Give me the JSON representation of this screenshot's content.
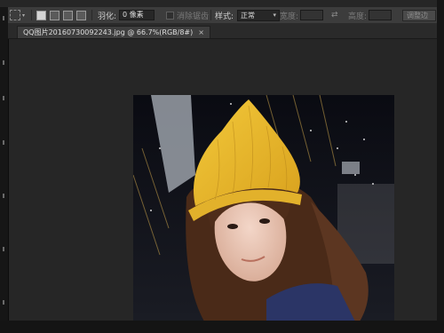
{
  "options_bar": {
    "feather_label": "羽化:",
    "feather_value": "0 像素",
    "anti_alias_label": "消除锯齿",
    "style_label": "样式:",
    "style_value": "正常",
    "width_label": "宽度:",
    "height_label": "高度:",
    "adjust_edge_label": "调整边"
  },
  "document": {
    "tab_title": "QQ图片20160730092243.jpg @ 66.7%(RGB/8#)",
    "close_symbol": "×"
  },
  "photo": {
    "description_colors": {
      "hat": "#e8b92c",
      "hair": "#5a3420",
      "sweater": "#2b3566",
      "background": "#0c0d14"
    }
  }
}
